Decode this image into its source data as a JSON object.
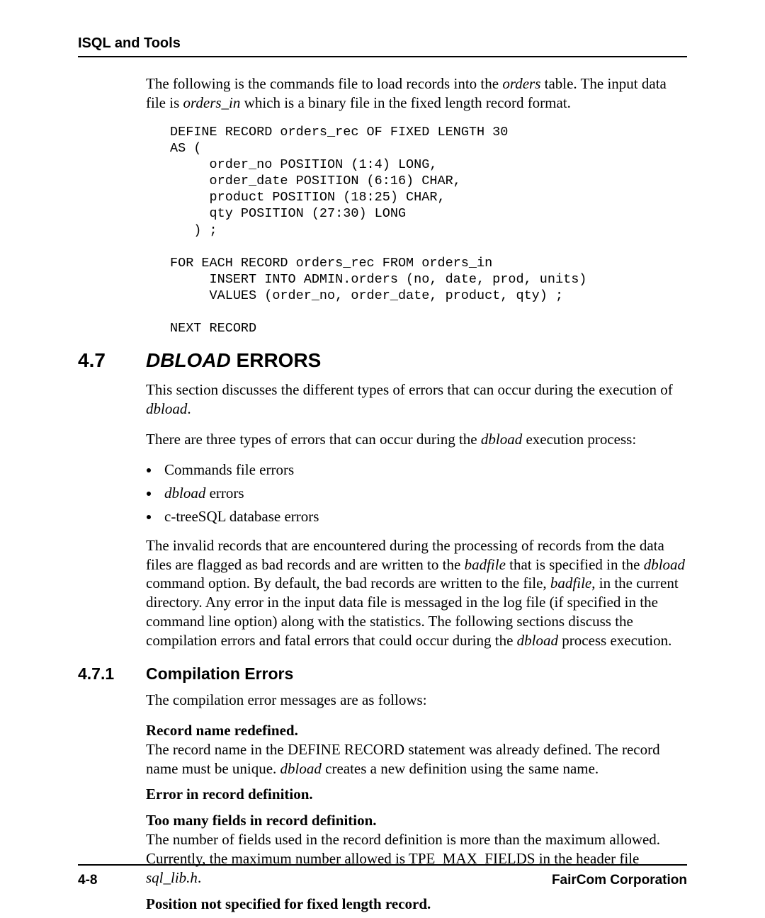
{
  "header": {
    "running": "ISQL and Tools"
  },
  "intro": {
    "p1_a": "The following is the commands file to load records into the ",
    "p1_b": "orders",
    "p1_c": " table. The input data file is ",
    "p1_d": "orders_in",
    "p1_e": " which is a binary file in the fixed length record format."
  },
  "code": "DEFINE RECORD orders_rec OF FIXED LENGTH 30\nAS (\n     order_no POSITION (1:4) LONG,\n     order_date POSITION (6:16) CHAR,\n     product POSITION (18:25) CHAR,\n     qty POSITION (27:30) LONG\n   ) ;\n\nFOR EACH RECORD orders_rec FROM orders_in\n     INSERT INTO ADMIN.orders (no, date, prod, units)\n     VALUES (order_no, order_date, product, qty) ;\n\nNEXT RECORD",
  "sec47": {
    "num": "4.7",
    "title_ital": "DBLOAD",
    "title_rest": " ERRORS",
    "p1_a": "This section discusses the different types of errors that can occur during the execution of ",
    "p1_b": "dbload",
    "p1_c": ".",
    "p2_a": "There are three types of errors that can occur during the ",
    "p2_b": "dbload",
    "p2_c": " execution process:",
    "bullets": {
      "b1": "Commands file errors",
      "b2_a": "dbload",
      "b2_b": " errors",
      "b3": "c-treeSQL database errors"
    },
    "p3_a": "The invalid records that are encountered during the processing of records from the data files are flagged as bad records and are written to the ",
    "p3_b": "badfile",
    "p3_c": " that is specified in the ",
    "p3_d": "dbload",
    "p3_e": " command option. By default, the bad records are written to the file, ",
    "p3_f": "badfile",
    "p3_g": ", in the current directory. Any error in the input data file is messaged in the log file (if specified in the command line option) along with the statistics. The following sections discuss the compilation errors and fatal errors that could occur during the ",
    "p3_h": "dbload",
    "p3_i": " process execution."
  },
  "sec471": {
    "num": "4.7.1",
    "title": "Compilation Errors",
    "p1": "The compilation error messages are as follows:",
    "t1": "Record name redefined.",
    "d1_a": "The record name in the DEFINE RECORD statement was already defined. The record name must be unique. ",
    "d1_b": "dbload",
    "d1_c": " creates a new definition using the same name.",
    "t2": "Error in record definition.",
    "t3": "Too many fields in record definition.",
    "d3_a": "The number of fields used in the record definition is more than the maximum allowed. Currently, the maximum number allowed is TPE_MAX_FIELDS in the header file ",
    "d3_b": "sql_lib.h",
    "d3_c": ".",
    "t4": "Position not specified for fixed length record."
  },
  "footer": {
    "left": "4-8",
    "right": "FairCom Corporation"
  }
}
